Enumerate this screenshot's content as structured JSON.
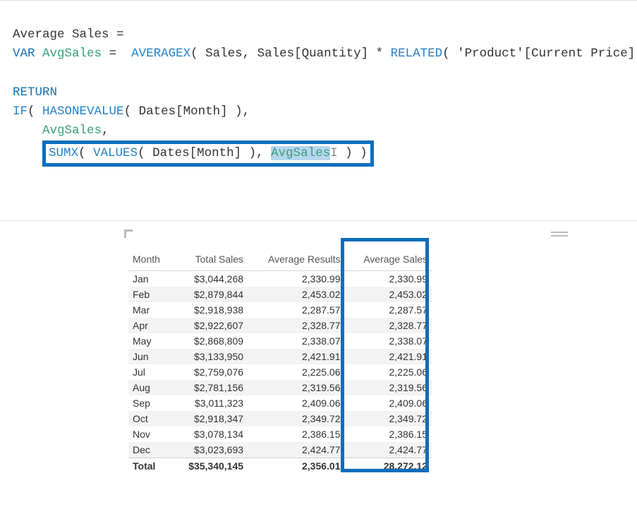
{
  "formula": {
    "measure_name": "Average Sales",
    "equals": " =",
    "kw_var": "VAR",
    "var_name": "AvgSales",
    "op_eq": " = ",
    "fn_averagex": " AVERAGEX",
    "args_averagex_1": "( Sales, Sales[Quantity] ",
    "op_mul": "*",
    "fn_related": " RELATED",
    "args_related": "( 'Product'[Current Price] ) )",
    "kw_return": "RETURN",
    "fn_if": "IF",
    "paren_open": "( ",
    "fn_hasonevalue": "HASONEVALUE",
    "args_hov": "( Dates[Month] ),",
    "varref_avgsales": "AvgSales",
    "comma": ",",
    "fn_sumx": "SUMX",
    "fn_values": "VALUES",
    "args_values": "( Dates[Month] ),",
    "box_part2": " ",
    "box_varref": "AvgSales",
    "cursor_char": "I",
    "box_close": " ) )"
  },
  "table": {
    "headers": {
      "month": "Month",
      "total_sales": "Total Sales",
      "avg_results": "Average Results",
      "avg_sales": "Average Sales"
    },
    "rows": [
      {
        "m": "Jan",
        "ts": "$3,044,268",
        "ar": "2,330.99",
        "as": "2,330.99"
      },
      {
        "m": "Feb",
        "ts": "$2,879,844",
        "ar": "2,453.02",
        "as": "2,453.02"
      },
      {
        "m": "Mar",
        "ts": "$2,918,938",
        "ar": "2,287.57",
        "as": "2,287.57"
      },
      {
        "m": "Apr",
        "ts": "$2,922,607",
        "ar": "2,328.77",
        "as": "2,328.77"
      },
      {
        "m": "May",
        "ts": "$2,868,809",
        "ar": "2,338.07",
        "as": "2,338.07"
      },
      {
        "m": "Jun",
        "ts": "$3,133,950",
        "ar": "2,421.91",
        "as": "2,421.91"
      },
      {
        "m": "Jul",
        "ts": "$2,759,076",
        "ar": "2,225.06",
        "as": "2,225.06"
      },
      {
        "m": "Aug",
        "ts": "$2,781,156",
        "ar": "2,319.56",
        "as": "2,319.56"
      },
      {
        "m": "Sep",
        "ts": "$3,011,323",
        "ar": "2,409.06",
        "as": "2,409.06"
      },
      {
        "m": "Oct",
        "ts": "$2,918,347",
        "ar": "2,349.72",
        "as": "2,349.72"
      },
      {
        "m": "Nov",
        "ts": "$3,078,134",
        "ar": "2,386.15",
        "as": "2,386.15"
      },
      {
        "m": "Dec",
        "ts": "$3,023,693",
        "ar": "2,424.77",
        "as": "2,424.77"
      }
    ],
    "total": {
      "m": "Total",
      "ts": "$35,340,145",
      "ar": "2,356.01",
      "as": "28,272.12"
    }
  },
  "colors": {
    "highlight_border": "#0a6ebd"
  }
}
